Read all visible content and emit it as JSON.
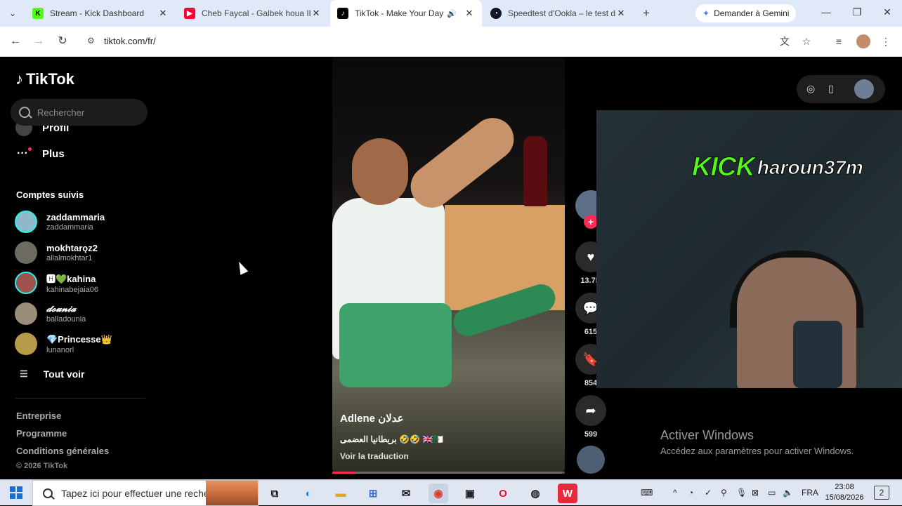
{
  "browser": {
    "tabs": [
      {
        "title": "Stream - Kick Dashboard",
        "favicon": "kick-icon",
        "color": "#53fc18"
      },
      {
        "title": "Cheb Faycal - Galbek houa Ibalek",
        "favicon": "youtube-icon",
        "color": "#ff0033"
      },
      {
        "title": "TikTok - Make Your Day",
        "favicon": "tiktok-icon",
        "color": "#000000",
        "active": true
      },
      {
        "title": "Speedtest d'Ookla – le test de",
        "favicon": "speedtest-icon",
        "color": "#141526"
      }
    ],
    "gemini_label": "Demander à Gemini",
    "url": "tiktok.com/fr/"
  },
  "sidebar": {
    "logo": "TikTok",
    "search_placeholder": "Rechercher",
    "profil_label": "Profil",
    "plus_label": "Plus",
    "following_title": "Comptes suivis",
    "accounts": [
      {
        "name": "zaddammaria",
        "handle": "zaddammaria",
        "avatar_color": "#8fb8c8"
      },
      {
        "name": "mokhtarǫz2",
        "handle": "allalmokhtar1",
        "avatar_color": "#6e6b60"
      },
      {
        "name": "🅷💚kahina",
        "handle": "kahinabejaia06",
        "avatar_color": "#a0524f"
      },
      {
        "name": "𝓭𝓸𝓾𝓷𝓲𝓪",
        "handle": "balladounia",
        "avatar_color": "#9a8e7a"
      },
      {
        "name": "💎Princesse👑",
        "handle": "lunanorl",
        "avatar_color": "#b79a4a"
      }
    ],
    "see_all_label": "Tout voir",
    "footer_links": [
      "Entreprise",
      "Programme",
      "Conditions générales"
    ],
    "copyright": "© 2026 TikTok"
  },
  "video": {
    "author": "Adlene عدلان",
    "caption": "بريطانيا العضمى 🤣🤣 🇬🇧🇩🇿",
    "translate_label": "Voir la traduction",
    "progress": 0.1,
    "likes": "13.7K",
    "comments": "615",
    "saves": "854",
    "shares": "599"
  },
  "overlay": {
    "platform": "KICK",
    "username": "haroun37m"
  },
  "watermark": {
    "title": "Activer Windows",
    "subtitle": "Accédez aux paramètres pour activer Windows."
  },
  "taskbar": {
    "search_placeholder": "Tapez ici pour effectuer une recherche",
    "language": "FRA",
    "time": "23:08",
    "date": "15/08/2026",
    "notifications": "2"
  }
}
